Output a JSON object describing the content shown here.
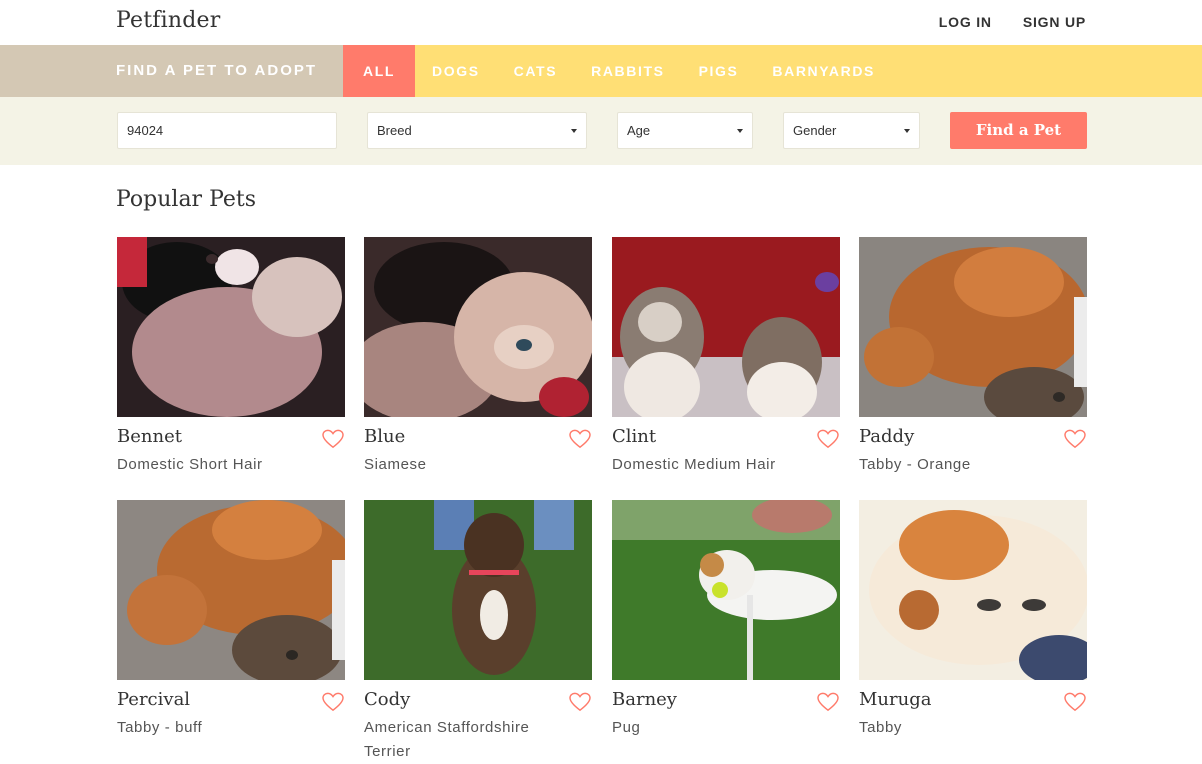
{
  "header": {
    "logo": "Petfinder",
    "login": "LOG IN",
    "signup": "SIGN UP"
  },
  "categories": {
    "title": "FIND A PET TO ADOPT",
    "items": [
      "ALL",
      "DOGS",
      "CATS",
      "RABBITS",
      "PIGS",
      "BARNYARDS"
    ],
    "active": "ALL"
  },
  "search": {
    "zip_value": "94024",
    "breed_selected": "Breed",
    "age_selected": "Age",
    "gender_selected": "Gender",
    "button_label": "Find a Pet"
  },
  "popular": {
    "title": "Popular Pets",
    "pets": [
      {
        "name": "Bennet",
        "breed": "Domestic Short Hair"
      },
      {
        "name": "Blue",
        "breed": "Siamese"
      },
      {
        "name": "Clint",
        "breed": "Domestic Medium Hair"
      },
      {
        "name": "Paddy",
        "breed": "Tabby - Orange"
      },
      {
        "name": "Percival",
        "breed": "Tabby - buff"
      },
      {
        "name": "Cody",
        "breed": "American Staffordshire Terrier"
      },
      {
        "name": "Barney",
        "breed": "Pug"
      },
      {
        "name": "Muruga",
        "breed": "Tabby"
      }
    ]
  },
  "colors": {
    "accent": "#ff7b6b",
    "category_band": "#ffdf75",
    "adopt_band": "#d4c8b4",
    "search_band": "#f4f3e6"
  }
}
